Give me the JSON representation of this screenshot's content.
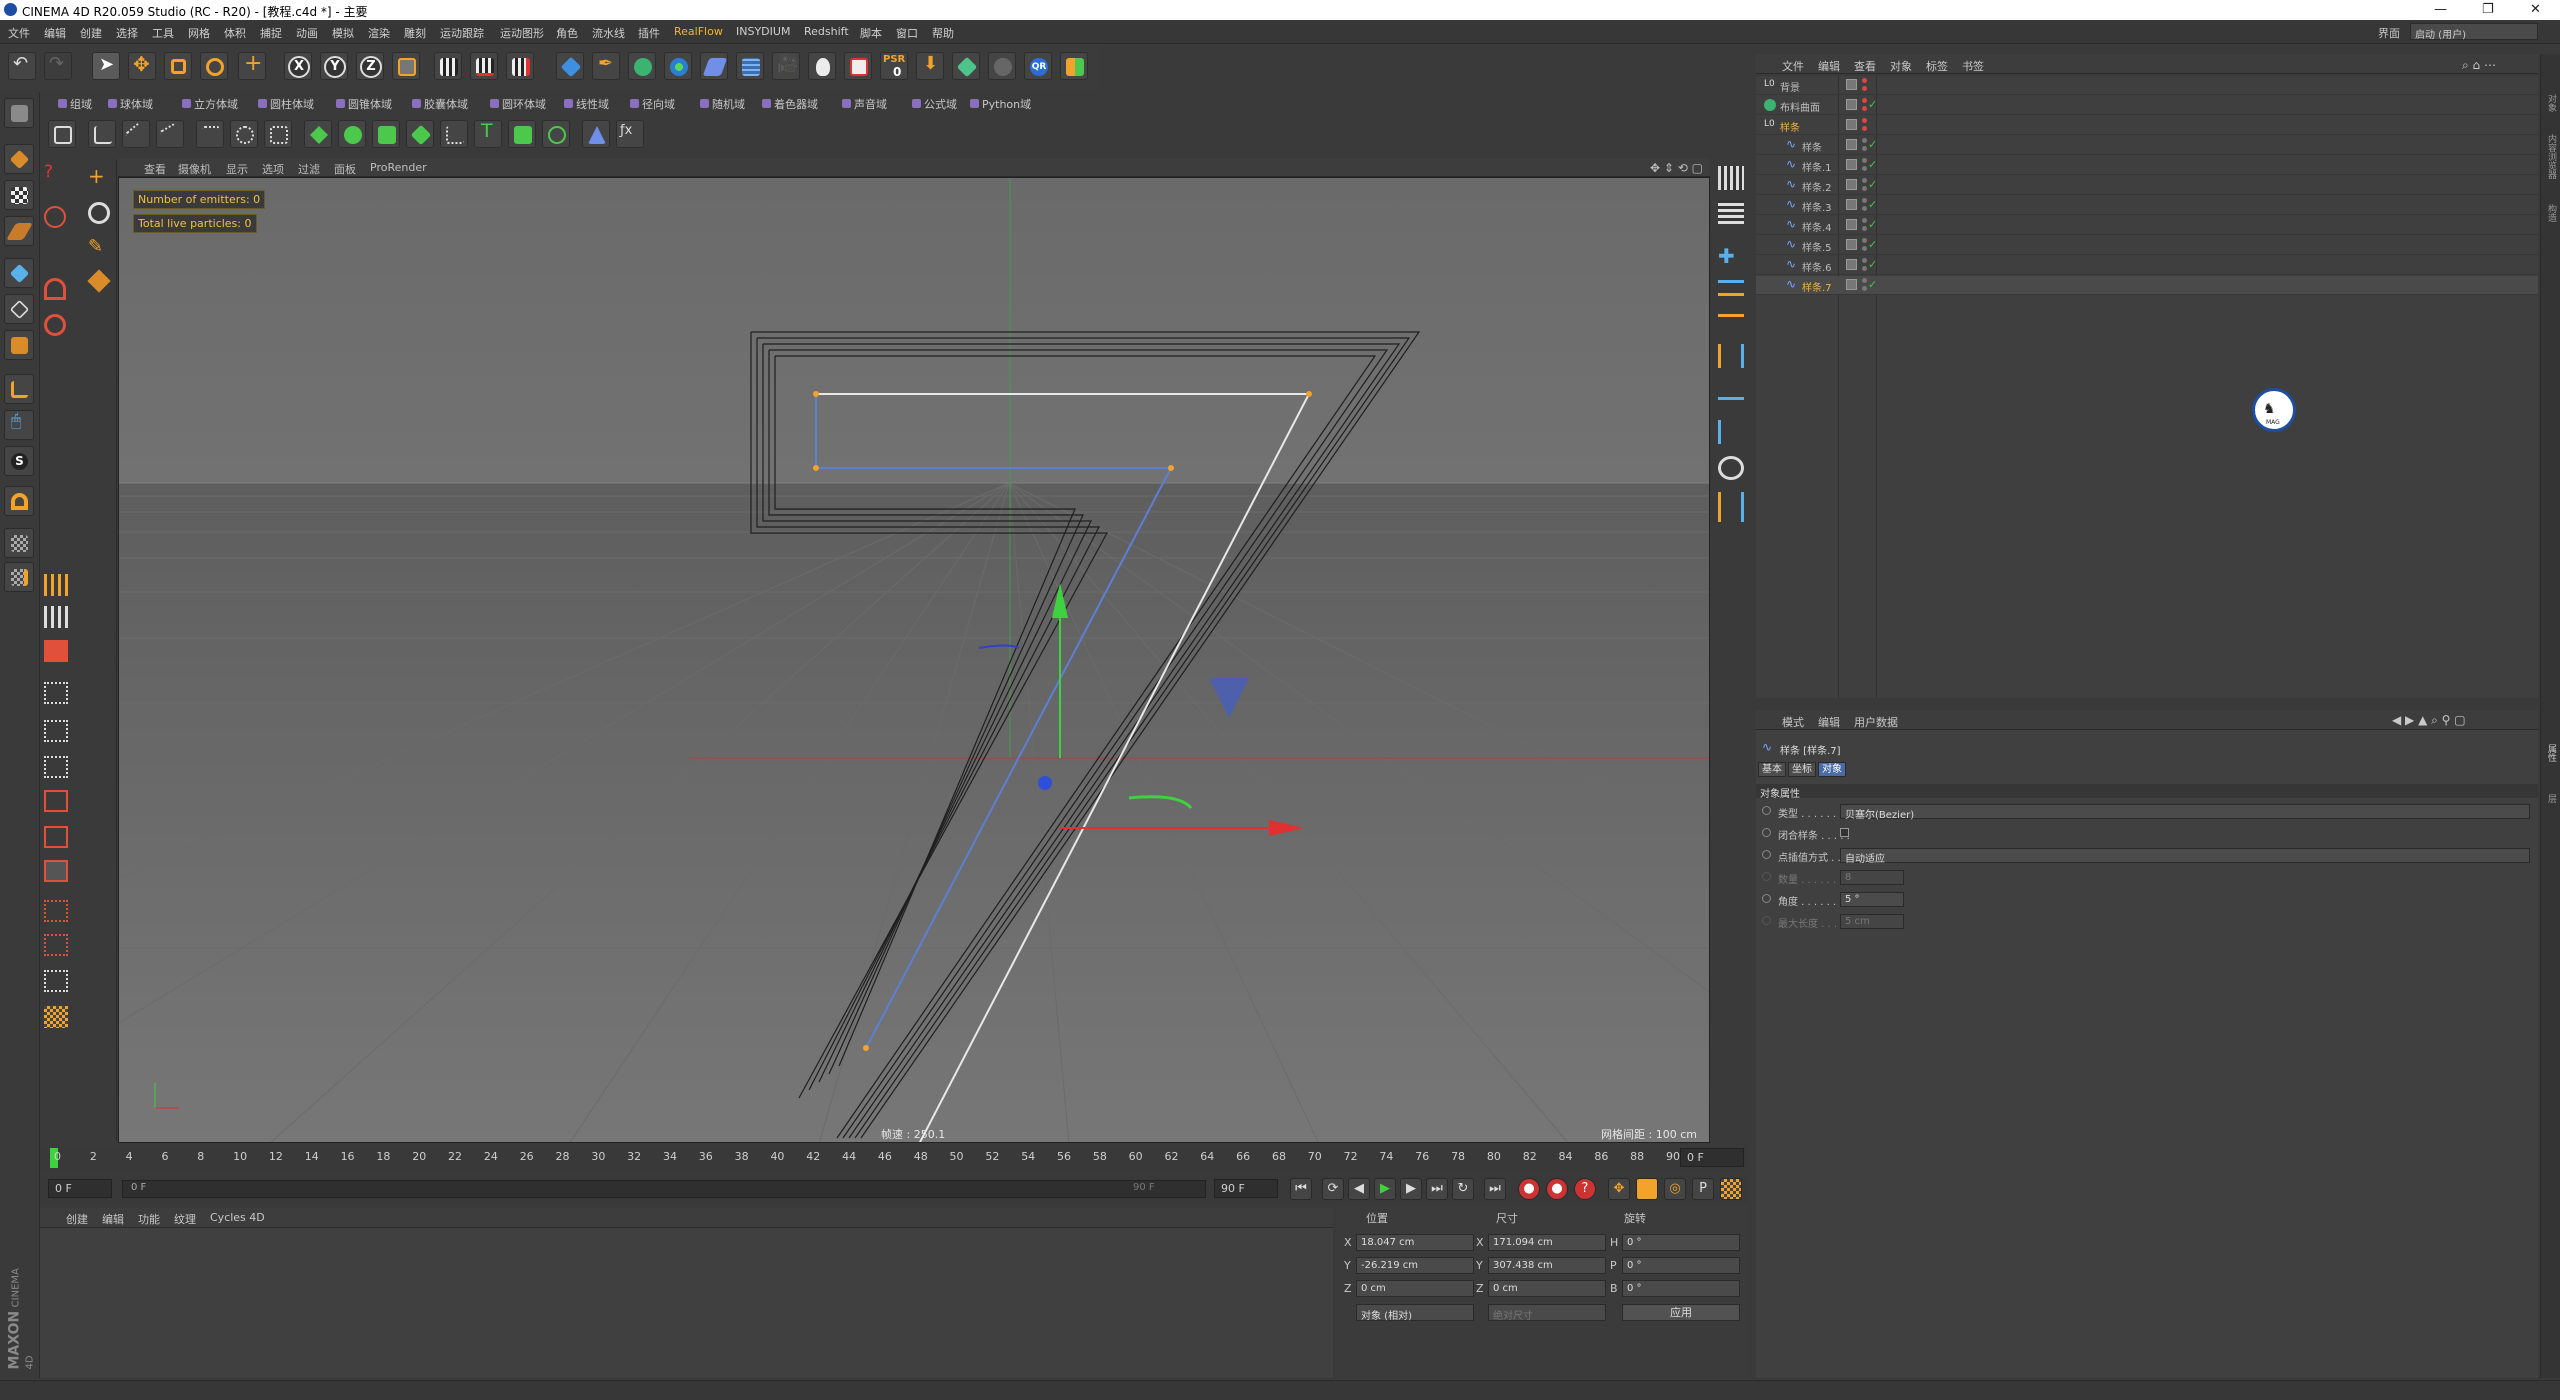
{
  "window": {
    "title": "CINEMA 4D R20.059 Studio (RC - R20) - [教程.c4d *] - 主要",
    "min": "—",
    "max": "❐",
    "close": "✕"
  },
  "menu": [
    "文件",
    "编辑",
    "创建",
    "选择",
    "工具",
    "网格",
    "体积",
    "捕捉",
    "动画",
    "模拟",
    "渲染",
    "雕刻",
    "运动跟踪",
    "运动图形",
    "角色",
    "流水线",
    "插件",
    "RealFlow",
    "INSYDIUM",
    "Redshift",
    "脚本",
    "窗口",
    "帮助"
  ],
  "layout": {
    "label": "界面",
    "value": "启动 (用户)"
  },
  "toolbar_icons": [
    "undo-icon",
    "redo-icon",
    "select-icon",
    "move-icon",
    "scale-icon",
    "rotate-icon",
    "add-icon",
    "x-axis-icon",
    "y-axis-icon",
    "z-axis-icon",
    "coord-system-icon",
    "render-view-icon",
    "render-pic-icon",
    "render-settings-icon",
    "cube-icon",
    "pen-icon",
    "subdivide-icon",
    "array-icon",
    "deformer-icon",
    "floor-icon",
    "camera-icon",
    "light-icon",
    "picture-viewer-icon",
    "psr-icon",
    "arrow-down-icon",
    "diamond-icon",
    "sphere-grey-icon",
    "qr-icon",
    "plugin-icon"
  ],
  "toolbar_labels": {
    "psr": "PSR",
    "psr_num": "0",
    "qr": "QR",
    "x": "X",
    "y": "Y",
    "z": "Z"
  },
  "field_bar": [
    "组域",
    "球体域",
    "立方体域",
    "圆柱体域",
    "圆锥体域",
    "胶囊体域",
    "圆环体域",
    "线性域",
    "径向域",
    "随机域",
    "着色器域",
    "声音域",
    "公式域",
    "Python域"
  ],
  "viewport": {
    "menu": [
      "查看",
      "摄像机",
      "显示",
      "选项",
      "过滤",
      "面板",
      "ProRender"
    ],
    "view_name": "透视视图",
    "hud": {
      "emitters": "Number of emitters: 0",
      "particles": "Total live particles: 0"
    },
    "fps": "帧速 : 250.1",
    "grid_spacing": "网格间距 : 100 cm"
  },
  "timeline": {
    "ticks": [
      "0",
      "2",
      "4",
      "6",
      "8",
      "10",
      "12",
      "14",
      "16",
      "18",
      "20",
      "22",
      "24",
      "26",
      "28",
      "30",
      "32",
      "34",
      "36",
      "38",
      "40",
      "42",
      "44",
      "46",
      "48",
      "50",
      "52",
      "54",
      "56",
      "58",
      "60",
      "62",
      "64",
      "66",
      "68",
      "70",
      "72",
      "74",
      "76",
      "78",
      "80",
      "82",
      "84",
      "86",
      "88",
      "90"
    ],
    "current": "0 F",
    "start": "0 F",
    "range_start": "0 F",
    "range_end": "90 F",
    "end": "90 F"
  },
  "materials": {
    "menu": [
      "创建",
      "编辑",
      "功能",
      "纹理",
      "Cycles 4D"
    ]
  },
  "coordinates": {
    "headers": {
      "pos": "位置",
      "size": "尺寸",
      "rot": "旋转"
    },
    "rows": [
      {
        "axis": "X",
        "pos": "18.047 cm",
        "size_axis": "X",
        "size": "171.094 cm",
        "rot_axis": "H",
        "rot": "0 °"
      },
      {
        "axis": "Y",
        "pos": "-26.219 cm",
        "size_axis": "Y",
        "size": "307.438 cm",
        "rot_axis": "P",
        "rot": "0 °"
      },
      {
        "axis": "Z",
        "pos": "0 cm",
        "size_axis": "Z",
        "size": "0 cm",
        "rot_axis": "B",
        "rot": "0 °"
      }
    ],
    "mode": "对象 (相对)",
    "size_mode": "绝对尺寸",
    "apply": "应用"
  },
  "object_manager": {
    "menu": [
      "文件",
      "编辑",
      "查看",
      "对象",
      "标签",
      "书签"
    ],
    "objects": [
      {
        "name": "背景",
        "indent": 0,
        "type": "null"
      },
      {
        "name": "布料曲面",
        "indent": 0,
        "type": "cloth"
      },
      {
        "name": "样条",
        "indent": 0,
        "type": "null",
        "active": true
      },
      {
        "name": "样条",
        "indent": 1,
        "type": "spline"
      },
      {
        "name": "样条.1",
        "indent": 1,
        "type": "spline"
      },
      {
        "name": "样条.2",
        "indent": 1,
        "type": "spline"
      },
      {
        "name": "样条.3",
        "indent": 1,
        "type": "spline"
      },
      {
        "name": "样条.4",
        "indent": 1,
        "type": "spline"
      },
      {
        "name": "样条.5",
        "indent": 1,
        "type": "spline"
      },
      {
        "name": "样条.6",
        "indent": 1,
        "type": "spline"
      },
      {
        "name": "样条.7",
        "indent": 1,
        "type": "spline",
        "selected": true
      }
    ],
    "logo_text": "MAG"
  },
  "attributes": {
    "menu": [
      "模式",
      "编辑",
      "用户数据"
    ],
    "title": "样条 [样条.7]",
    "tabs": [
      "基本",
      "坐标",
      "对象"
    ],
    "section": "对象属性",
    "fields": [
      {
        "label": "类型 . . . . . . . .",
        "value": "贝塞尔(Bezier)",
        "kind": "dropdown"
      },
      {
        "label": "闭合样条 . . . . .",
        "value": "",
        "kind": "checkbox"
      },
      {
        "label": "点插值方式 . . .",
        "value": "自动适应",
        "kind": "dropdown"
      },
      {
        "label": "数量 . . . . . . . .",
        "value": "8",
        "kind": "number",
        "disabled": true
      },
      {
        "label": "角度 . . . . . . . .",
        "value": "5 °",
        "kind": "number"
      },
      {
        "label": "最大长度 . . . . .",
        "value": "5 cm",
        "kind": "number",
        "disabled": true
      }
    ]
  },
  "brand": {
    "maxon": "MAXON",
    "product": "CINEMA 4D"
  }
}
